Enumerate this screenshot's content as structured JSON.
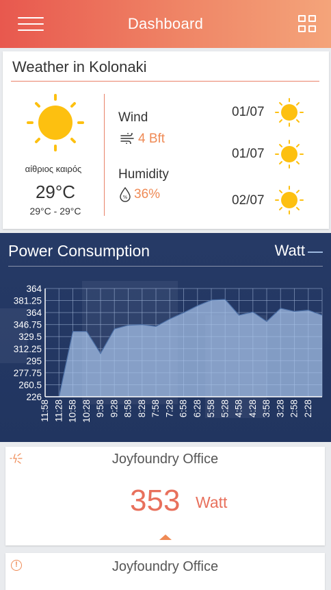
{
  "header": {
    "title": "Dashboard",
    "menu_icon": "hamburger-icon",
    "grid_icon": "grid-icon"
  },
  "weather": {
    "title": "Weather in Kolonaki",
    "condition": "αίθριος καιρός",
    "temperature": "29°C",
    "temp_range": "29°C - 29°C",
    "wind_label": "Wind",
    "wind_value": "4 Bft",
    "humidity_label": "Humidity",
    "humidity_value": "36%",
    "forecast": [
      {
        "date": "01/07",
        "icon": "sun-icon"
      },
      {
        "date": "01/07",
        "icon": "sun-icon"
      },
      {
        "date": "02/07",
        "icon": "sun-icon"
      }
    ]
  },
  "power": {
    "title": "Power Consumption",
    "unit": "Watt"
  },
  "chart_data": {
    "type": "area",
    "title": "Power Consumption",
    "series": [
      {
        "name": "Watt",
        "values": [
          226,
          226,
          330,
          330,
          295,
          334,
          340,
          341,
          338,
          350,
          360,
          371,
          380,
          381,
          356,
          361,
          346,
          367,
          362,
          364,
          356
        ]
      }
    ],
    "x": [
      "11:58",
      "11:28",
      "10:58",
      "10:28",
      "9:58",
      "9:28",
      "8:58",
      "8:28",
      "7:58",
      "7:28",
      "6:58",
      "6:28",
      "5:58",
      "5:28",
      "4:58",
      "4:28",
      "3:58",
      "3:28",
      "2:58",
      "2:28"
    ],
    "yticks": [
      "364",
      "381.25",
      "364",
      "346.75",
      "329.5",
      "312.25",
      "295",
      "277.75",
      "260.5",
      "226"
    ],
    "ylim": [
      226,
      398.5
    ],
    "grid": true,
    "colors": {
      "fill": "#a7c4ea",
      "line": "#4b6fa6",
      "grid": "#9fb4d5"
    }
  },
  "offices": [
    {
      "name": "Joyfoundry Office",
      "value": "353",
      "unit": "Watt",
      "icon": "power-spark-icon"
    },
    {
      "name": "Joyfoundry Office",
      "icon": "warning-icon"
    }
  ],
  "colors": {
    "accent": "#ef8a55",
    "header_start": "#e8584e",
    "header_end": "#f4a47a",
    "panel": "#243864"
  }
}
